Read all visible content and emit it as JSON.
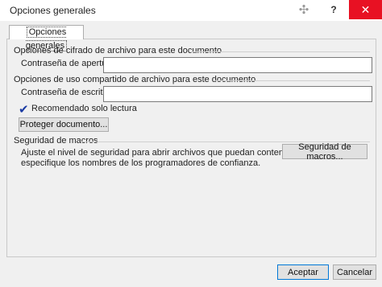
{
  "window": {
    "title": "Opciones generales",
    "buttons": {
      "restore": "✣",
      "help": "?",
      "close": "✕"
    }
  },
  "tab": {
    "label": "Opciones generales"
  },
  "encryption": {
    "title": "Opciones de cifrado de archivo para este documento",
    "open_password_label": "Contraseña de apertura:",
    "open_password_value": ""
  },
  "sharing": {
    "title": "Opciones de uso compartido de archivo para este documento",
    "write_password_label": "Contraseña de escritura:",
    "write_password_value": "",
    "readonly_label": "Recomendado solo lectura",
    "readonly_checked": true,
    "protect_button": "Proteger documento..."
  },
  "macro": {
    "title": "Seguridad de macros",
    "description_line1": "Ajuste el nivel de seguridad para abrir archivos que puedan contener virus y",
    "description_line2": "especifique los nombres de los programadores de confianza.",
    "button": "Seguridad de macros..."
  },
  "footer": {
    "ok": "Aceptar",
    "cancel": "Cancelar"
  }
}
